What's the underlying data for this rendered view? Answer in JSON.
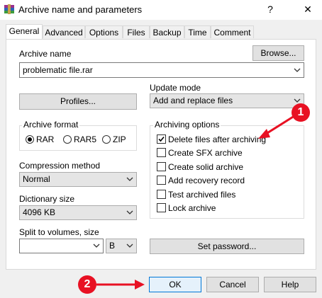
{
  "window": {
    "title": "Archive name and parameters",
    "help_glyph": "?",
    "close_glyph": "✕"
  },
  "tabs": [
    "General",
    "Advanced",
    "Options",
    "Files",
    "Backup",
    "Time",
    "Comment"
  ],
  "archive_name": {
    "label": "Archive name",
    "value": "problematic file.rar",
    "browse_label": "Browse..."
  },
  "profiles_label": "Profiles...",
  "update_mode": {
    "label": "Update mode",
    "value": "Add and replace files"
  },
  "archive_format": {
    "label": "Archive format",
    "options": [
      "RAR",
      "RAR5",
      "ZIP"
    ],
    "selected": "RAR"
  },
  "archiving_options": {
    "label": "Archiving options",
    "items": [
      {
        "label": "Delete files after archiving",
        "checked": true
      },
      {
        "label": "Create SFX archive",
        "checked": false
      },
      {
        "label": "Create solid archive",
        "checked": false
      },
      {
        "label": "Add recovery record",
        "checked": false
      },
      {
        "label": "Test archived files",
        "checked": false
      },
      {
        "label": "Lock archive",
        "checked": false
      }
    ]
  },
  "compression": {
    "label": "Compression method",
    "value": "Normal"
  },
  "dictionary": {
    "label": "Dictionary size",
    "value": "4096 KB"
  },
  "split": {
    "label": "Split to volumes, size",
    "value": "",
    "unit": "B"
  },
  "set_password_label": "Set password...",
  "buttons": {
    "ok": "OK",
    "cancel": "Cancel",
    "help": "Help"
  },
  "annotations": {
    "badge1": "1",
    "badge2": "2",
    "color": "#e81123"
  }
}
